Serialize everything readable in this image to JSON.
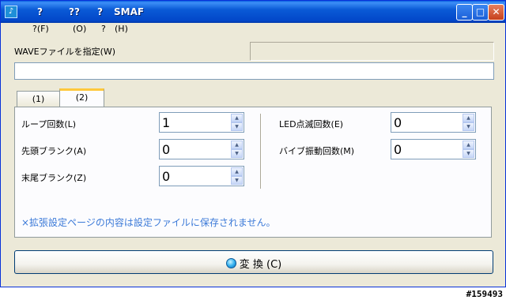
{
  "window": {
    "title_parts": [
      "?",
      "??",
      "?",
      "SMAF"
    ],
    "buttons": {
      "minimize": "_",
      "maximize": "□",
      "close": "✕"
    }
  },
  "menu": [
    {
      "label": "?(F)"
    },
    {
      "label": "(O)"
    },
    {
      "label": "?"
    },
    {
      "label": "(H)"
    }
  ],
  "wave": {
    "label": "WAVEファイルを指定(W)",
    "value": ""
  },
  "tabs": [
    {
      "label": "(1)",
      "active": false
    },
    {
      "label": "(2)",
      "active": true
    }
  ],
  "fields_left": [
    {
      "label": "ループ回数(L)",
      "value": "1"
    },
    {
      "label": "先頭ブランク(A)",
      "value": "0"
    },
    {
      "label": "末尾ブランク(Z)",
      "value": "0"
    }
  ],
  "fields_right": [
    {
      "label": "LED点滅回数(E)",
      "value": "0"
    },
    {
      "label": "バイブ振動回数(M)",
      "value": "0"
    }
  ],
  "note": "×拡張設定ページの内容は設定ファイルに保存されません。",
  "convert_button": {
    "label": "変 換 (C)"
  },
  "watermark": "#159493",
  "colors": {
    "titlebar": "#0a5ad6",
    "note": "#3c7ad8",
    "tab_highlight": "#ffc83c"
  }
}
